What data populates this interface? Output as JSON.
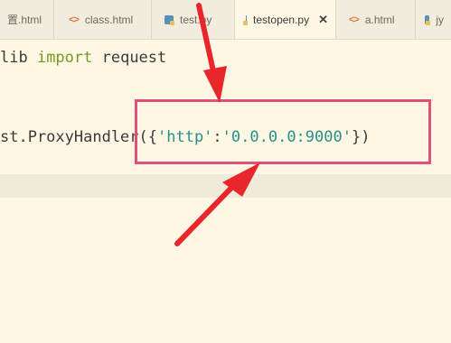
{
  "tabs": [
    {
      "label": "置.html",
      "icon": "html-file-icon",
      "icon_glyph": "",
      "active": false
    },
    {
      "label": "class.html",
      "icon": "html-file-icon",
      "icon_glyph": "<>",
      "active": false
    },
    {
      "label": "test.py",
      "icon": "python-file-icon",
      "icon_glyph": "",
      "active": false
    },
    {
      "label": "testopen.py",
      "icon": "python-file-icon",
      "icon_glyph": "",
      "active": true,
      "close": "✕"
    },
    {
      "label": "a.html",
      "icon": "html-file-icon",
      "icon_glyph": "<>",
      "active": false
    },
    {
      "label": "jy",
      "icon": "python-file-icon",
      "icon_glyph": "",
      "active": false
    }
  ],
  "code": {
    "line1": {
      "prefix": "lib ",
      "keyword": "import",
      "suffix": " request"
    },
    "line2": {
      "prefix": "st.ProxyHandler({",
      "str1": "'http'",
      "colon": ":",
      "str2": "'0.0.0.0:9000'",
      "suffix": "})"
    }
  },
  "colors": {
    "highlight_box": "#e0507a",
    "arrow": "#e8262b",
    "background": "#fdf7e4"
  }
}
